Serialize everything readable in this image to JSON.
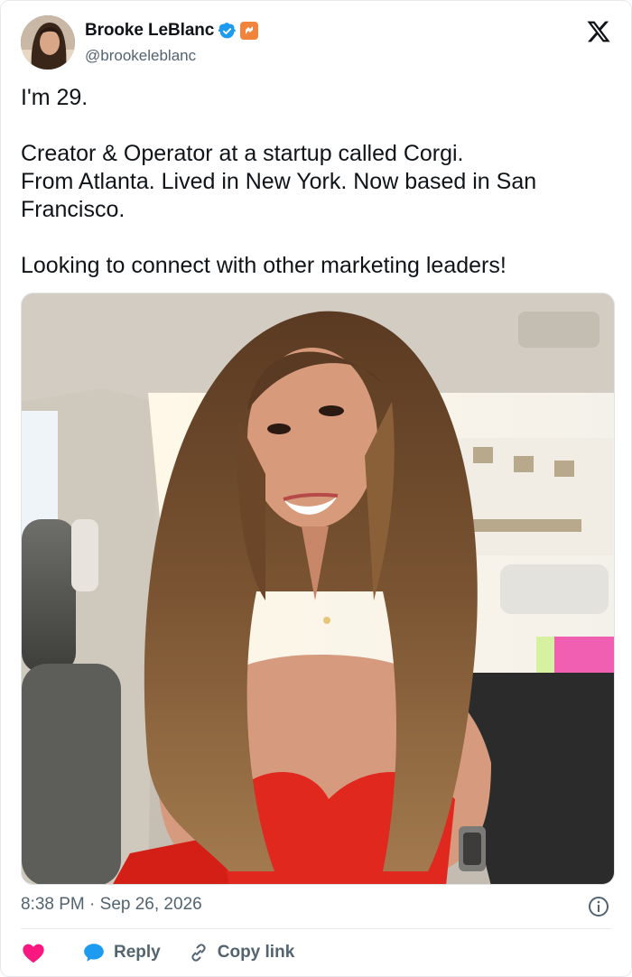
{
  "author": {
    "display_name": "Brooke LeBlanc",
    "handle": "@brookeleblanc",
    "verified": true
  },
  "tweet": {
    "text": "I'm 29.\n\nCreator & Operator at a startup called Corgi.\nFrom Atlanta. Lived in New York. Now based in San Francisco.\n\nLooking to connect with other marketing leaders!",
    "time": "8:38 PM",
    "separator": "·",
    "date": "Sep 26, 2026"
  },
  "actions": {
    "reply_label": "Reply",
    "copy_link_label": "Copy link"
  },
  "colors": {
    "like": "#f91880",
    "reply": "#1d9bf0",
    "verified": "#1d9bf0",
    "affiliate_badge": "#f0843c",
    "muted_text": "#536471"
  },
  "icons": [
    "x-logo-icon",
    "verified-badge-icon",
    "affiliate-badge-icon",
    "info-icon",
    "heart-icon",
    "reply-bubble-icon",
    "link-icon"
  ]
}
